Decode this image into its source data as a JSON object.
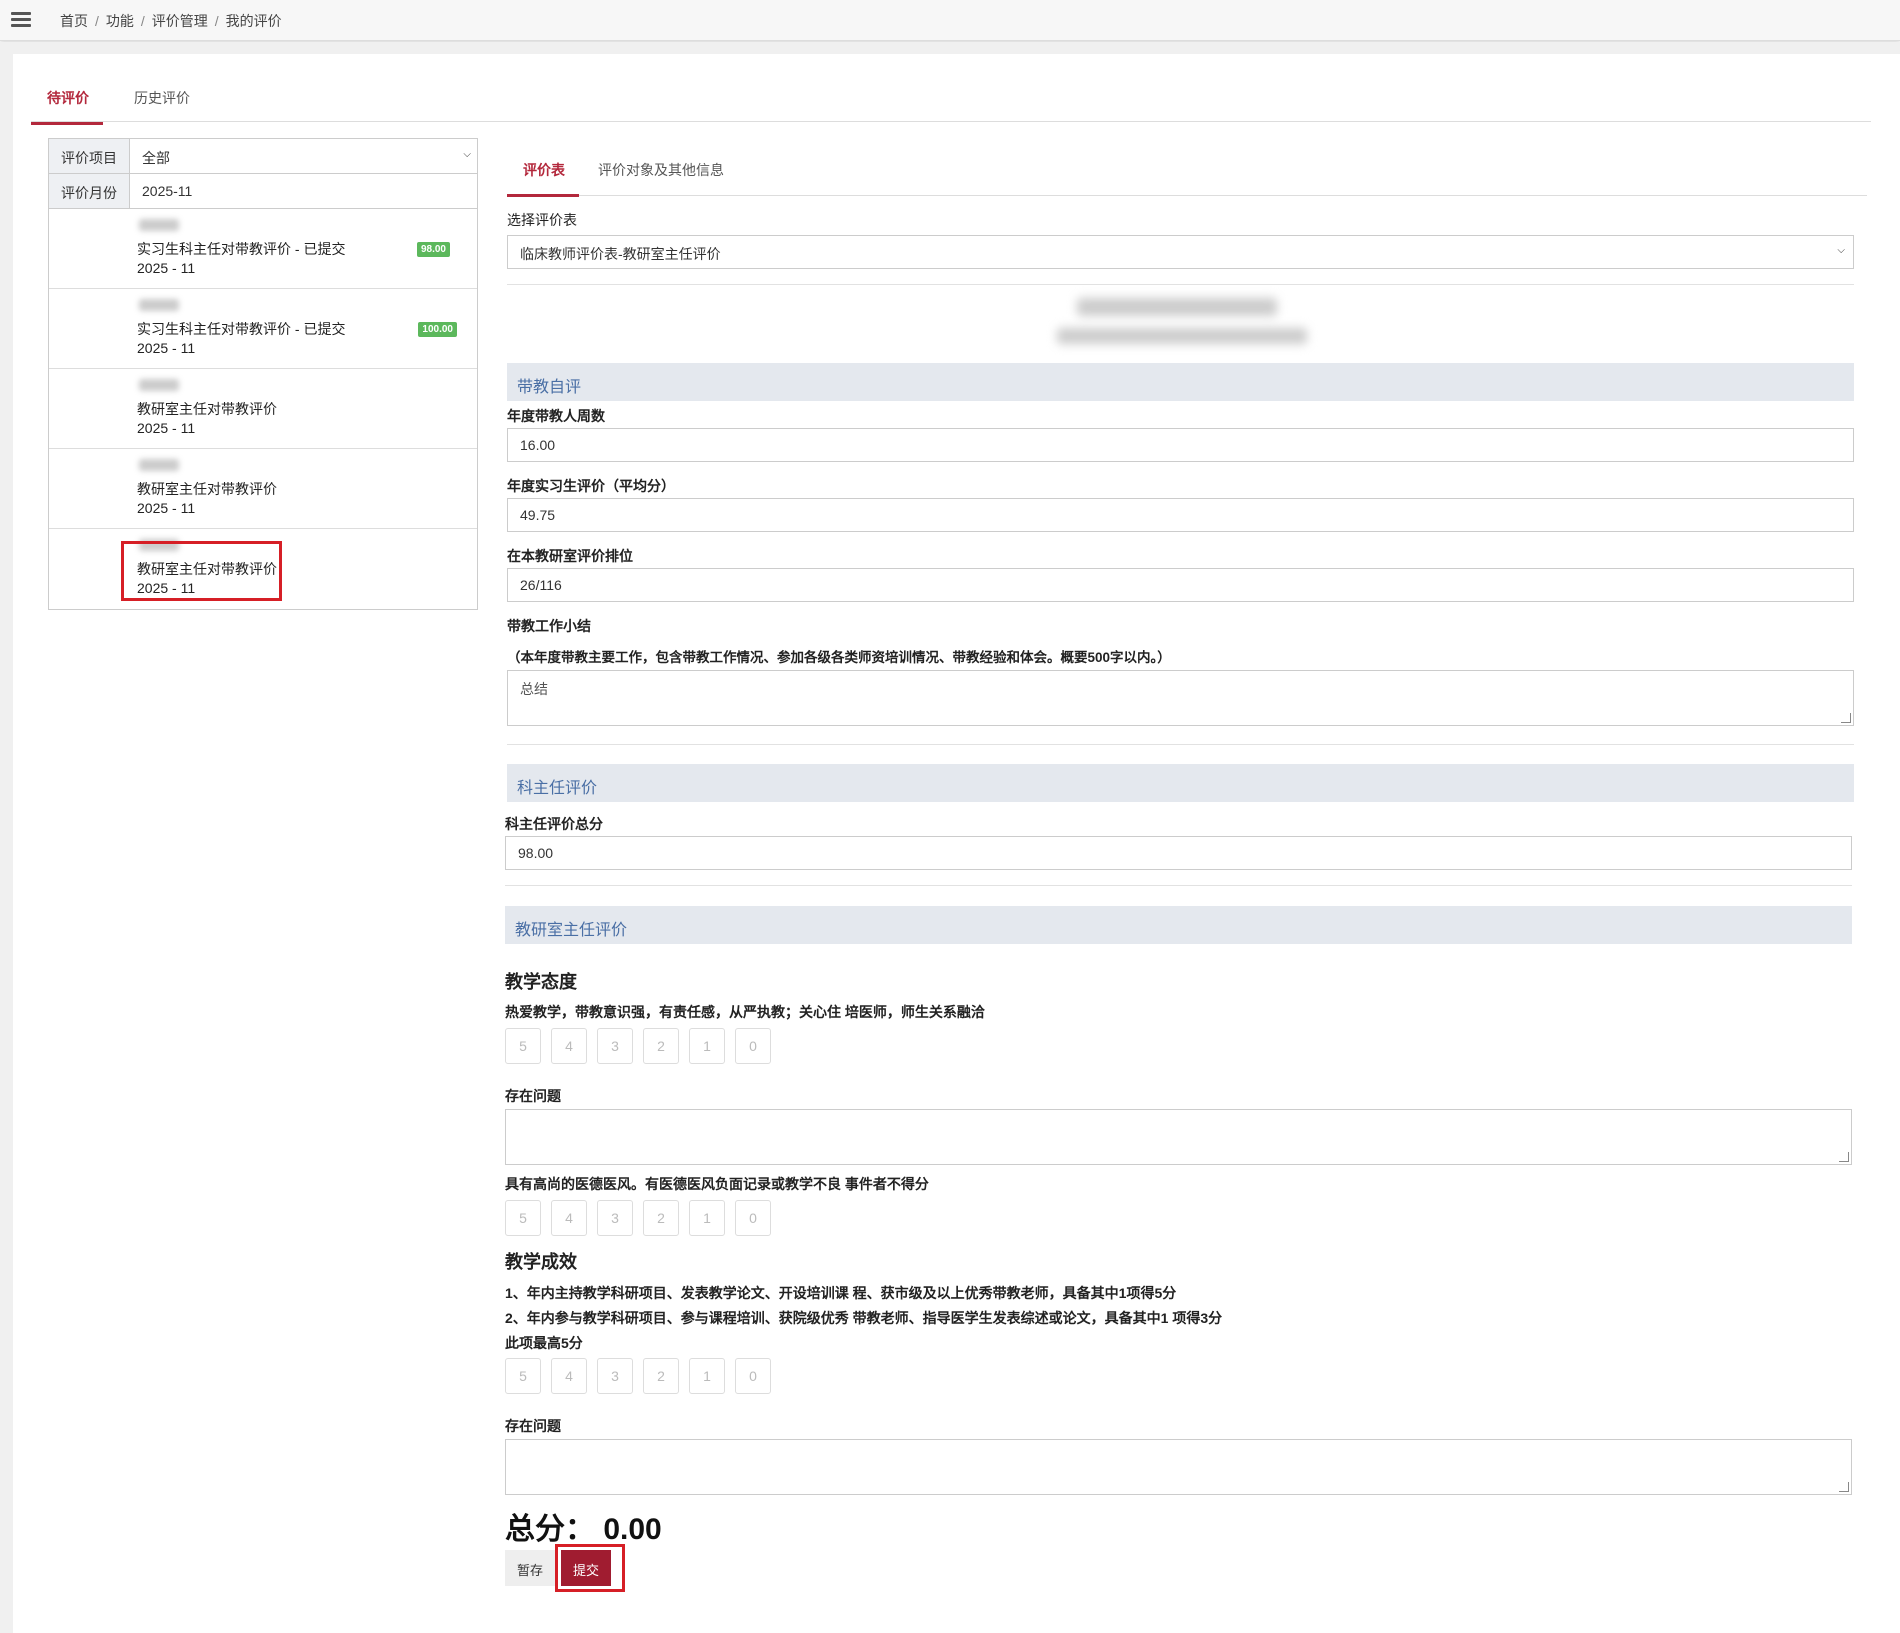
{
  "breadcrumb": [
    "首页",
    "功能",
    "评价管理",
    "我的评价"
  ],
  "tabs": {
    "pending": "待评价",
    "history": "历史评价"
  },
  "filters": {
    "project_label": "评价项目",
    "project_value": "全部",
    "month_label": "评价月份",
    "month_value": "2025-11"
  },
  "list": [
    {
      "title": "实习生科主任对带教评价 - 已提交",
      "date": "2025 - 11",
      "score": "98.00"
    },
    {
      "title": "实习生科主任对带教评价 - 已提交",
      "date": "2025 - 11",
      "score": "100.00"
    },
    {
      "title": "教研室主任对带教评价",
      "date": "2025 - 11"
    },
    {
      "title": "教研室主任对带教评价",
      "date": "2025 - 11"
    },
    {
      "title": "教研室主任对带教评价",
      "date": "2025 - 11"
    }
  ],
  "right_tabs": {
    "form": "评价表",
    "info": "评价对象及其他信息"
  },
  "form": {
    "select_label": "选择评价表",
    "select_value": "临床教师评价表-教研室主任评价",
    "section_self": "带教自评",
    "weeks_label": "年度带教人周数",
    "weeks_value": "16.00",
    "intern_label": "年度实习生评价（平均分）",
    "intern_value": "49.75",
    "rank_label": "在本教研室评价排位",
    "rank_value": "26/116",
    "summary_label": "带教工作小结",
    "summary_hint": "（本年度带教主要工作，包含带教工作情况、参加各级各类师资培训情况、带教经验和体会。概要500字以内。）",
    "summary_value": "总结",
    "section_dept": "科主任评价",
    "dept_total_label": "科主任评价总分",
    "dept_total_value": "98.00",
    "section_director": "教研室主任评价",
    "attitude_title": "教学态度",
    "attitude_desc": "热爱教学，带教意识强，有责任感，从严执教；关心住 培医师，师生关系融洽",
    "problem_label": "存在问题",
    "ethics_desc": "具有高尚的医德医风。有医德医风负面记录或教学不良 事件者不得分",
    "result_title": "教学成效",
    "result_desc1": "1、年内主持教学科研项目、发表教学论文、开设培训课 程、获市级及以上优秀带教老师，具备其中1项得5分",
    "result_desc2": "2、年内参与教学科研项目、参与课程培训、获院级优秀 带教老师、指导医学生发表综述或论文，具备其中1 项得3分",
    "result_desc3": "此项最高5分",
    "problem_label2": "存在问题",
    "ratings": [
      "5",
      "4",
      "3",
      "2",
      "1",
      "0"
    ],
    "total": "总分： 0.00",
    "save_label": "暂存",
    "submit_label": "提交"
  }
}
